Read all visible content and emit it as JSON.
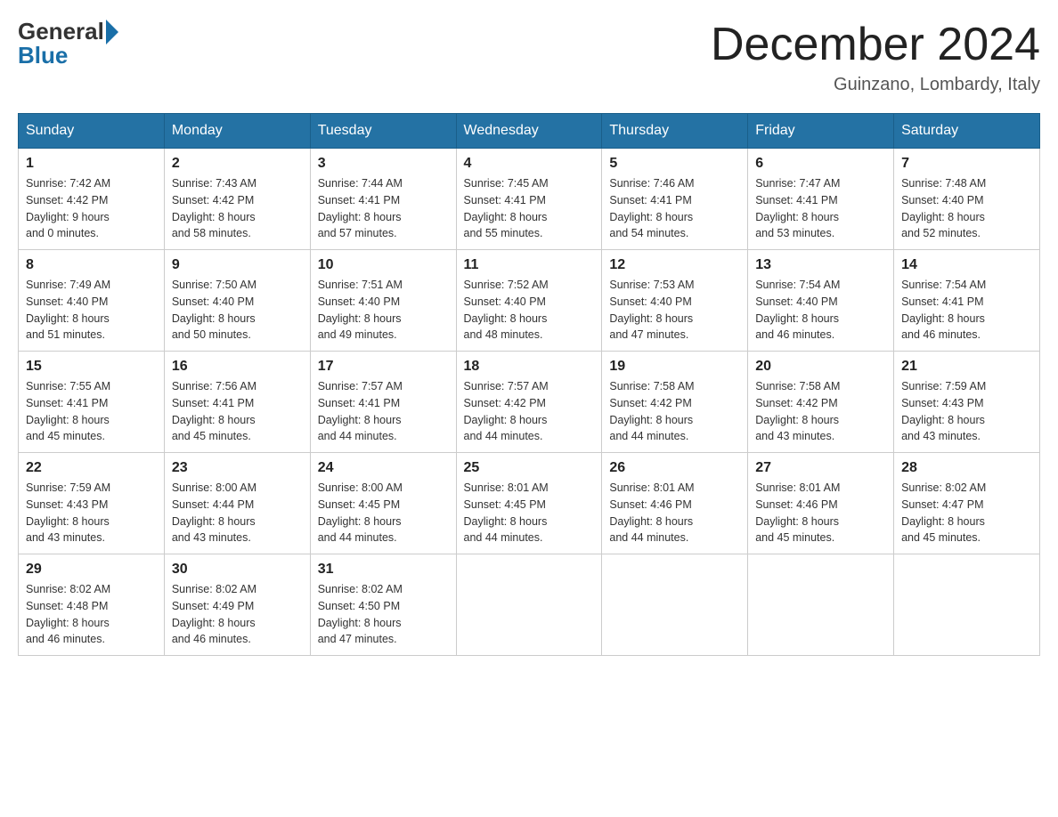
{
  "header": {
    "logo_general": "General",
    "logo_blue": "Blue",
    "month_title": "December 2024",
    "subtitle": "Guinzano, Lombardy, Italy"
  },
  "weekdays": [
    "Sunday",
    "Monday",
    "Tuesday",
    "Wednesday",
    "Thursday",
    "Friday",
    "Saturday"
  ],
  "weeks": [
    [
      {
        "day": "1",
        "info": "Sunrise: 7:42 AM\nSunset: 4:42 PM\nDaylight: 9 hours\nand 0 minutes."
      },
      {
        "day": "2",
        "info": "Sunrise: 7:43 AM\nSunset: 4:42 PM\nDaylight: 8 hours\nand 58 minutes."
      },
      {
        "day": "3",
        "info": "Sunrise: 7:44 AM\nSunset: 4:41 PM\nDaylight: 8 hours\nand 57 minutes."
      },
      {
        "day": "4",
        "info": "Sunrise: 7:45 AM\nSunset: 4:41 PM\nDaylight: 8 hours\nand 55 minutes."
      },
      {
        "day": "5",
        "info": "Sunrise: 7:46 AM\nSunset: 4:41 PM\nDaylight: 8 hours\nand 54 minutes."
      },
      {
        "day": "6",
        "info": "Sunrise: 7:47 AM\nSunset: 4:41 PM\nDaylight: 8 hours\nand 53 minutes."
      },
      {
        "day": "7",
        "info": "Sunrise: 7:48 AM\nSunset: 4:40 PM\nDaylight: 8 hours\nand 52 minutes."
      }
    ],
    [
      {
        "day": "8",
        "info": "Sunrise: 7:49 AM\nSunset: 4:40 PM\nDaylight: 8 hours\nand 51 minutes."
      },
      {
        "day": "9",
        "info": "Sunrise: 7:50 AM\nSunset: 4:40 PM\nDaylight: 8 hours\nand 50 minutes."
      },
      {
        "day": "10",
        "info": "Sunrise: 7:51 AM\nSunset: 4:40 PM\nDaylight: 8 hours\nand 49 minutes."
      },
      {
        "day": "11",
        "info": "Sunrise: 7:52 AM\nSunset: 4:40 PM\nDaylight: 8 hours\nand 48 minutes."
      },
      {
        "day": "12",
        "info": "Sunrise: 7:53 AM\nSunset: 4:40 PM\nDaylight: 8 hours\nand 47 minutes."
      },
      {
        "day": "13",
        "info": "Sunrise: 7:54 AM\nSunset: 4:40 PM\nDaylight: 8 hours\nand 46 minutes."
      },
      {
        "day": "14",
        "info": "Sunrise: 7:54 AM\nSunset: 4:41 PM\nDaylight: 8 hours\nand 46 minutes."
      }
    ],
    [
      {
        "day": "15",
        "info": "Sunrise: 7:55 AM\nSunset: 4:41 PM\nDaylight: 8 hours\nand 45 minutes."
      },
      {
        "day": "16",
        "info": "Sunrise: 7:56 AM\nSunset: 4:41 PM\nDaylight: 8 hours\nand 45 minutes."
      },
      {
        "day": "17",
        "info": "Sunrise: 7:57 AM\nSunset: 4:41 PM\nDaylight: 8 hours\nand 44 minutes."
      },
      {
        "day": "18",
        "info": "Sunrise: 7:57 AM\nSunset: 4:42 PM\nDaylight: 8 hours\nand 44 minutes."
      },
      {
        "day": "19",
        "info": "Sunrise: 7:58 AM\nSunset: 4:42 PM\nDaylight: 8 hours\nand 44 minutes."
      },
      {
        "day": "20",
        "info": "Sunrise: 7:58 AM\nSunset: 4:42 PM\nDaylight: 8 hours\nand 43 minutes."
      },
      {
        "day": "21",
        "info": "Sunrise: 7:59 AM\nSunset: 4:43 PM\nDaylight: 8 hours\nand 43 minutes."
      }
    ],
    [
      {
        "day": "22",
        "info": "Sunrise: 7:59 AM\nSunset: 4:43 PM\nDaylight: 8 hours\nand 43 minutes."
      },
      {
        "day": "23",
        "info": "Sunrise: 8:00 AM\nSunset: 4:44 PM\nDaylight: 8 hours\nand 43 minutes."
      },
      {
        "day": "24",
        "info": "Sunrise: 8:00 AM\nSunset: 4:45 PM\nDaylight: 8 hours\nand 44 minutes."
      },
      {
        "day": "25",
        "info": "Sunrise: 8:01 AM\nSunset: 4:45 PM\nDaylight: 8 hours\nand 44 minutes."
      },
      {
        "day": "26",
        "info": "Sunrise: 8:01 AM\nSunset: 4:46 PM\nDaylight: 8 hours\nand 44 minutes."
      },
      {
        "day": "27",
        "info": "Sunrise: 8:01 AM\nSunset: 4:46 PM\nDaylight: 8 hours\nand 45 minutes."
      },
      {
        "day": "28",
        "info": "Sunrise: 8:02 AM\nSunset: 4:47 PM\nDaylight: 8 hours\nand 45 minutes."
      }
    ],
    [
      {
        "day": "29",
        "info": "Sunrise: 8:02 AM\nSunset: 4:48 PM\nDaylight: 8 hours\nand 46 minutes."
      },
      {
        "day": "30",
        "info": "Sunrise: 8:02 AM\nSunset: 4:49 PM\nDaylight: 8 hours\nand 46 minutes."
      },
      {
        "day": "31",
        "info": "Sunrise: 8:02 AM\nSunset: 4:50 PM\nDaylight: 8 hours\nand 47 minutes."
      },
      {
        "day": "",
        "info": ""
      },
      {
        "day": "",
        "info": ""
      },
      {
        "day": "",
        "info": ""
      },
      {
        "day": "",
        "info": ""
      }
    ]
  ]
}
